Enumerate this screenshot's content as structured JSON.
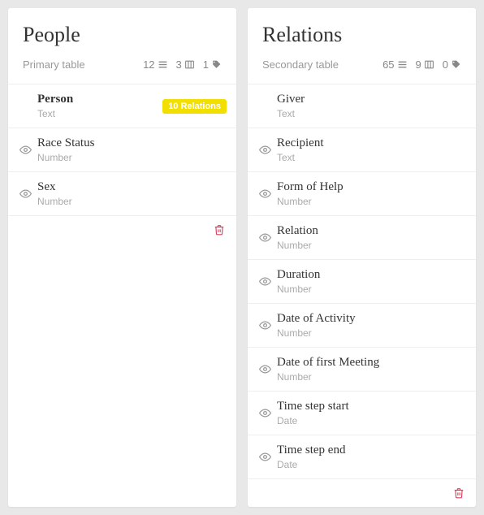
{
  "panels": [
    {
      "title": "People",
      "subtitle": "Primary table",
      "counts": {
        "rows": 12,
        "cols": 3,
        "tags": 1
      },
      "fields": [
        {
          "name": "Person",
          "type": "Text",
          "visible": false,
          "bold": true,
          "badge": "10 Relations"
        },
        {
          "name": "Race Status",
          "type": "Number",
          "visible": true,
          "bold": false
        },
        {
          "name": "Sex",
          "type": "Number",
          "visible": true,
          "bold": false
        }
      ]
    },
    {
      "title": "Relations",
      "subtitle": "Secondary table",
      "counts": {
        "rows": 65,
        "cols": 9,
        "tags": 0
      },
      "fields": [
        {
          "name": "Giver",
          "type": "Text",
          "visible": false,
          "bold": false
        },
        {
          "name": "Recipient",
          "type": "Text",
          "visible": true,
          "bold": false
        },
        {
          "name": "Form of Help",
          "type": "Number",
          "visible": true,
          "bold": false
        },
        {
          "name": "Relation",
          "type": "Number",
          "visible": true,
          "bold": false
        },
        {
          "name": "Duration",
          "type": "Number",
          "visible": true,
          "bold": false
        },
        {
          "name": "Date of Activity",
          "type": "Number",
          "visible": true,
          "bold": false
        },
        {
          "name": "Date of first Meeting",
          "type": "Number",
          "visible": true,
          "bold": false
        },
        {
          "name": "Time step start",
          "type": "Date",
          "visible": true,
          "bold": false
        },
        {
          "name": "Time step end",
          "type": "Date",
          "visible": true,
          "bold": false
        }
      ]
    }
  ]
}
